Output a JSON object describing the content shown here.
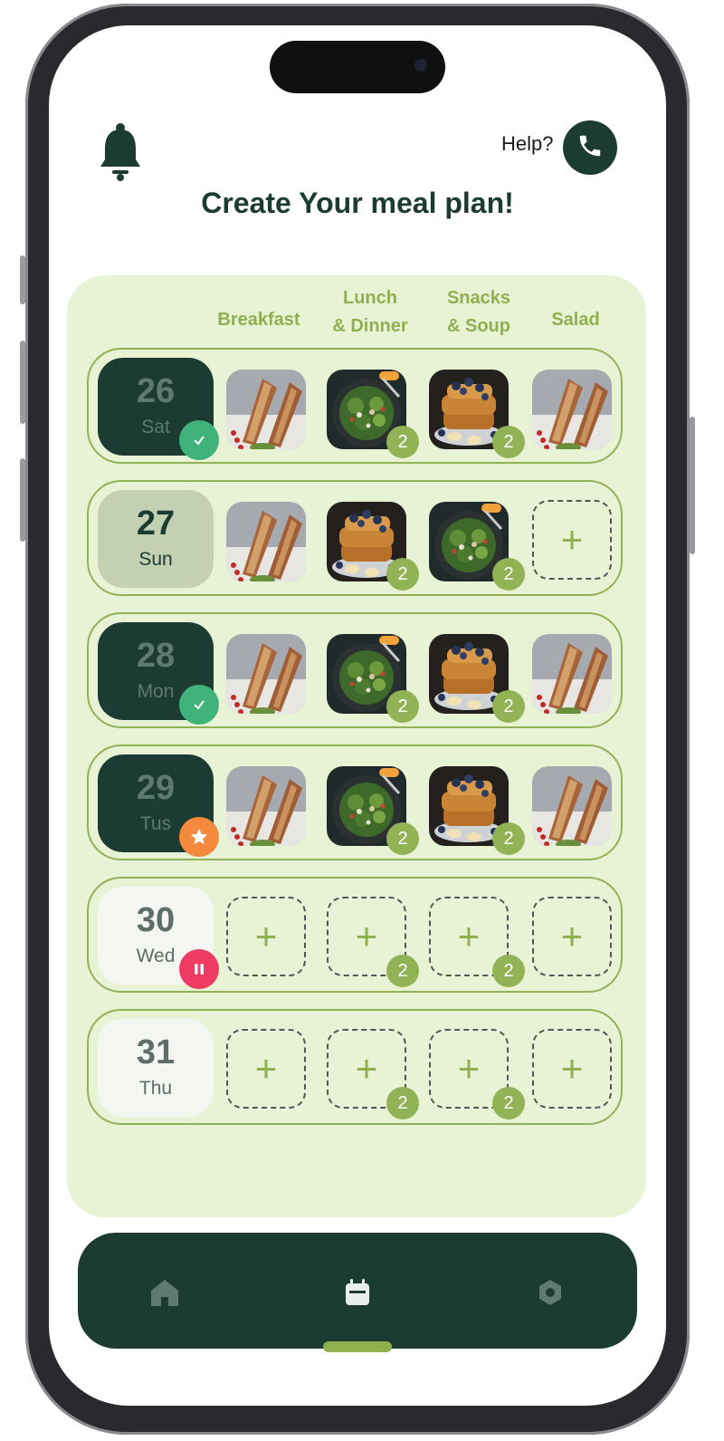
{
  "header": {
    "help_label": "Help?",
    "title": "Create Your meal plan!"
  },
  "columns": [
    "Breakfast",
    "Lunch\n& Dinner",
    "Snacks\n& Soup",
    "Salad"
  ],
  "days": [
    {
      "num": "26",
      "name": "Sat",
      "status": "done",
      "meals": [
        "sandwich",
        "salad",
        "french-toast",
        "sandwich"
      ],
      "counts": [
        "",
        "2",
        "2",
        ""
      ]
    },
    {
      "num": "27",
      "name": "Sun",
      "status": "selected",
      "meals": [
        "sandwich",
        "french-toast",
        "salad",
        "add"
      ],
      "counts": [
        "",
        "2",
        "2",
        ""
      ]
    },
    {
      "num": "28",
      "name": "Mon",
      "status": "done",
      "meals": [
        "sandwich",
        "salad",
        "french-toast",
        "sandwich"
      ],
      "counts": [
        "",
        "2",
        "2",
        ""
      ]
    },
    {
      "num": "29",
      "name": "Tus",
      "status": "starred",
      "meals": [
        "sandwich",
        "salad",
        "french-toast",
        "sandwich"
      ],
      "counts": [
        "",
        "2",
        "2",
        ""
      ]
    },
    {
      "num": "30",
      "name": "Wed",
      "status": "paused",
      "meals": [
        "add",
        "add",
        "add",
        "add"
      ],
      "counts": [
        "",
        "2",
        "2",
        ""
      ]
    },
    {
      "num": "31",
      "name": "Thu",
      "status": "empty",
      "meals": [
        "add",
        "add",
        "add",
        "add"
      ],
      "counts": [
        "",
        "2",
        "2",
        ""
      ]
    }
  ],
  "icons": {
    "notification": "bell-icon",
    "call": "phone-icon",
    "home": "home-icon",
    "calendar": "calendar-icon",
    "settings": "settings-icon",
    "add": "plus-icon"
  },
  "colors": {
    "primary_dark": "#1b3b33",
    "accent_green": "#8fb04f",
    "card_bg": "#e8f3d6",
    "done": "#3fb37a",
    "starred": "#f58a3c",
    "paused": "#ee3b63"
  },
  "nav": {
    "active": "calendar"
  }
}
